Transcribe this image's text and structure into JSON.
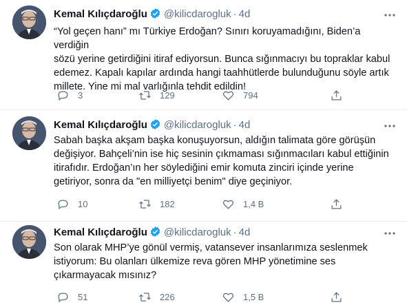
{
  "tweets": [
    {
      "author": "Kemal Kılıçdaroğlu",
      "handle": "@kilicdarogluk",
      "dot": "·",
      "time": "4d",
      "text": "“Yol geçen hanı” mı Türkiye Erdoğan? Sınırı koruyamadığını, Biden’a verdiğin\nsözü yerine getirdiğini itiraf ediyorsun. Bunca sığınmacıyı bu topraklar kabul\nedemez. Kapalı kapılar ardında hangi taahhütlerde bulunduğunu söyle artık\nmillete. Yine mi mal varlığınla tehdit edildin!",
      "replies": "3",
      "retweets": "129",
      "likes": "794"
    },
    {
      "author": "Kemal Kılıçdaroğlu",
      "handle": "@kilicdarogluk",
      "dot": "·",
      "time": "4d",
      "text": "Sabah başka akşam başka konuşuyorsun, aldığın talimata göre görüşün\ndeğişiyor. Bahçeli’nin ise hiç sesinin çıkmaması sığınmacıları kabul ettiğinin\nitirafıdır. Erdoğan’ın her söylediğini emir komuta zinciri içinde yerine\ngetiriyor, sonra da \"en milliyetçi benim\" diye geçiniyor.",
      "replies": "10",
      "retweets": "182",
      "likes": "1,4 B"
    },
    {
      "author": "Kemal Kılıçdaroğlu",
      "handle": "@kilicdarogluk",
      "dot": "·",
      "time": "4d",
      "text": "Son olarak MHP’ye gönül vermiş, vatansever insanlarımıza seslenmek\nistiyorum: Bu olanları ülkemize reva gören MHP yönetimine ses\nçıkarmayacak mısınız?",
      "replies": "51",
      "retweets": "226",
      "likes": "1,5 B"
    }
  ],
  "icons": {
    "verified": "verified-badge-icon",
    "more": "more-options-icon",
    "reply": "reply-icon",
    "retweet": "retweet-icon",
    "like": "like-icon",
    "share": "share-icon"
  },
  "colors": {
    "verified": "#1da1f2",
    "meta": "#5b7083",
    "separator": "#e6ecf0"
  }
}
